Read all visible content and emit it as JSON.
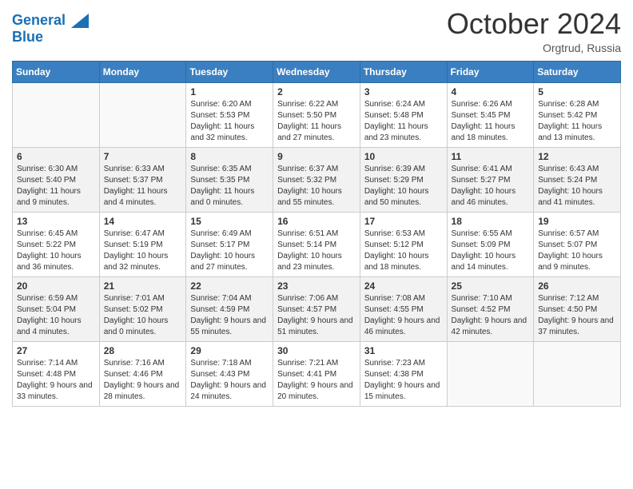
{
  "header": {
    "logo_line1": "General",
    "logo_line2": "Blue",
    "month": "October 2024",
    "location": "Orgtrud, Russia"
  },
  "weekdays": [
    "Sunday",
    "Monday",
    "Tuesday",
    "Wednesday",
    "Thursday",
    "Friday",
    "Saturday"
  ],
  "weeks": [
    [
      {
        "day": "",
        "sunrise": "",
        "sunset": "",
        "daylight": ""
      },
      {
        "day": "",
        "sunrise": "",
        "sunset": "",
        "daylight": ""
      },
      {
        "day": "1",
        "sunrise": "Sunrise: 6:20 AM",
        "sunset": "Sunset: 5:53 PM",
        "daylight": "Daylight: 11 hours and 32 minutes."
      },
      {
        "day": "2",
        "sunrise": "Sunrise: 6:22 AM",
        "sunset": "Sunset: 5:50 PM",
        "daylight": "Daylight: 11 hours and 27 minutes."
      },
      {
        "day": "3",
        "sunrise": "Sunrise: 6:24 AM",
        "sunset": "Sunset: 5:48 PM",
        "daylight": "Daylight: 11 hours and 23 minutes."
      },
      {
        "day": "4",
        "sunrise": "Sunrise: 6:26 AM",
        "sunset": "Sunset: 5:45 PM",
        "daylight": "Daylight: 11 hours and 18 minutes."
      },
      {
        "day": "5",
        "sunrise": "Sunrise: 6:28 AM",
        "sunset": "Sunset: 5:42 PM",
        "daylight": "Daylight: 11 hours and 13 minutes."
      }
    ],
    [
      {
        "day": "6",
        "sunrise": "Sunrise: 6:30 AM",
        "sunset": "Sunset: 5:40 PM",
        "daylight": "Daylight: 11 hours and 9 minutes."
      },
      {
        "day": "7",
        "sunrise": "Sunrise: 6:33 AM",
        "sunset": "Sunset: 5:37 PM",
        "daylight": "Daylight: 11 hours and 4 minutes."
      },
      {
        "day": "8",
        "sunrise": "Sunrise: 6:35 AM",
        "sunset": "Sunset: 5:35 PM",
        "daylight": "Daylight: 11 hours and 0 minutes."
      },
      {
        "day": "9",
        "sunrise": "Sunrise: 6:37 AM",
        "sunset": "Sunset: 5:32 PM",
        "daylight": "Daylight: 10 hours and 55 minutes."
      },
      {
        "day": "10",
        "sunrise": "Sunrise: 6:39 AM",
        "sunset": "Sunset: 5:29 PM",
        "daylight": "Daylight: 10 hours and 50 minutes."
      },
      {
        "day": "11",
        "sunrise": "Sunrise: 6:41 AM",
        "sunset": "Sunset: 5:27 PM",
        "daylight": "Daylight: 10 hours and 46 minutes."
      },
      {
        "day": "12",
        "sunrise": "Sunrise: 6:43 AM",
        "sunset": "Sunset: 5:24 PM",
        "daylight": "Daylight: 10 hours and 41 minutes."
      }
    ],
    [
      {
        "day": "13",
        "sunrise": "Sunrise: 6:45 AM",
        "sunset": "Sunset: 5:22 PM",
        "daylight": "Daylight: 10 hours and 36 minutes."
      },
      {
        "day": "14",
        "sunrise": "Sunrise: 6:47 AM",
        "sunset": "Sunset: 5:19 PM",
        "daylight": "Daylight: 10 hours and 32 minutes."
      },
      {
        "day": "15",
        "sunrise": "Sunrise: 6:49 AM",
        "sunset": "Sunset: 5:17 PM",
        "daylight": "Daylight: 10 hours and 27 minutes."
      },
      {
        "day": "16",
        "sunrise": "Sunrise: 6:51 AM",
        "sunset": "Sunset: 5:14 PM",
        "daylight": "Daylight: 10 hours and 23 minutes."
      },
      {
        "day": "17",
        "sunrise": "Sunrise: 6:53 AM",
        "sunset": "Sunset: 5:12 PM",
        "daylight": "Daylight: 10 hours and 18 minutes."
      },
      {
        "day": "18",
        "sunrise": "Sunrise: 6:55 AM",
        "sunset": "Sunset: 5:09 PM",
        "daylight": "Daylight: 10 hours and 14 minutes."
      },
      {
        "day": "19",
        "sunrise": "Sunrise: 6:57 AM",
        "sunset": "Sunset: 5:07 PM",
        "daylight": "Daylight: 10 hours and 9 minutes."
      }
    ],
    [
      {
        "day": "20",
        "sunrise": "Sunrise: 6:59 AM",
        "sunset": "Sunset: 5:04 PM",
        "daylight": "Daylight: 10 hours and 4 minutes."
      },
      {
        "day": "21",
        "sunrise": "Sunrise: 7:01 AM",
        "sunset": "Sunset: 5:02 PM",
        "daylight": "Daylight: 10 hours and 0 minutes."
      },
      {
        "day": "22",
        "sunrise": "Sunrise: 7:04 AM",
        "sunset": "Sunset: 4:59 PM",
        "daylight": "Daylight: 9 hours and 55 minutes."
      },
      {
        "day": "23",
        "sunrise": "Sunrise: 7:06 AM",
        "sunset": "Sunset: 4:57 PM",
        "daylight": "Daylight: 9 hours and 51 minutes."
      },
      {
        "day": "24",
        "sunrise": "Sunrise: 7:08 AM",
        "sunset": "Sunset: 4:55 PM",
        "daylight": "Daylight: 9 hours and 46 minutes."
      },
      {
        "day": "25",
        "sunrise": "Sunrise: 7:10 AM",
        "sunset": "Sunset: 4:52 PM",
        "daylight": "Daylight: 9 hours and 42 minutes."
      },
      {
        "day": "26",
        "sunrise": "Sunrise: 7:12 AM",
        "sunset": "Sunset: 4:50 PM",
        "daylight": "Daylight: 9 hours and 37 minutes."
      }
    ],
    [
      {
        "day": "27",
        "sunrise": "Sunrise: 7:14 AM",
        "sunset": "Sunset: 4:48 PM",
        "daylight": "Daylight: 9 hours and 33 minutes."
      },
      {
        "day": "28",
        "sunrise": "Sunrise: 7:16 AM",
        "sunset": "Sunset: 4:46 PM",
        "daylight": "Daylight: 9 hours and 28 minutes."
      },
      {
        "day": "29",
        "sunrise": "Sunrise: 7:18 AM",
        "sunset": "Sunset: 4:43 PM",
        "daylight": "Daylight: 9 hours and 24 minutes."
      },
      {
        "day": "30",
        "sunrise": "Sunrise: 7:21 AM",
        "sunset": "Sunset: 4:41 PM",
        "daylight": "Daylight: 9 hours and 20 minutes."
      },
      {
        "day": "31",
        "sunrise": "Sunrise: 7:23 AM",
        "sunset": "Sunset: 4:38 PM",
        "daylight": "Daylight: 9 hours and 15 minutes."
      },
      {
        "day": "",
        "sunrise": "",
        "sunset": "",
        "daylight": ""
      },
      {
        "day": "",
        "sunrise": "",
        "sunset": "",
        "daylight": ""
      }
    ]
  ]
}
